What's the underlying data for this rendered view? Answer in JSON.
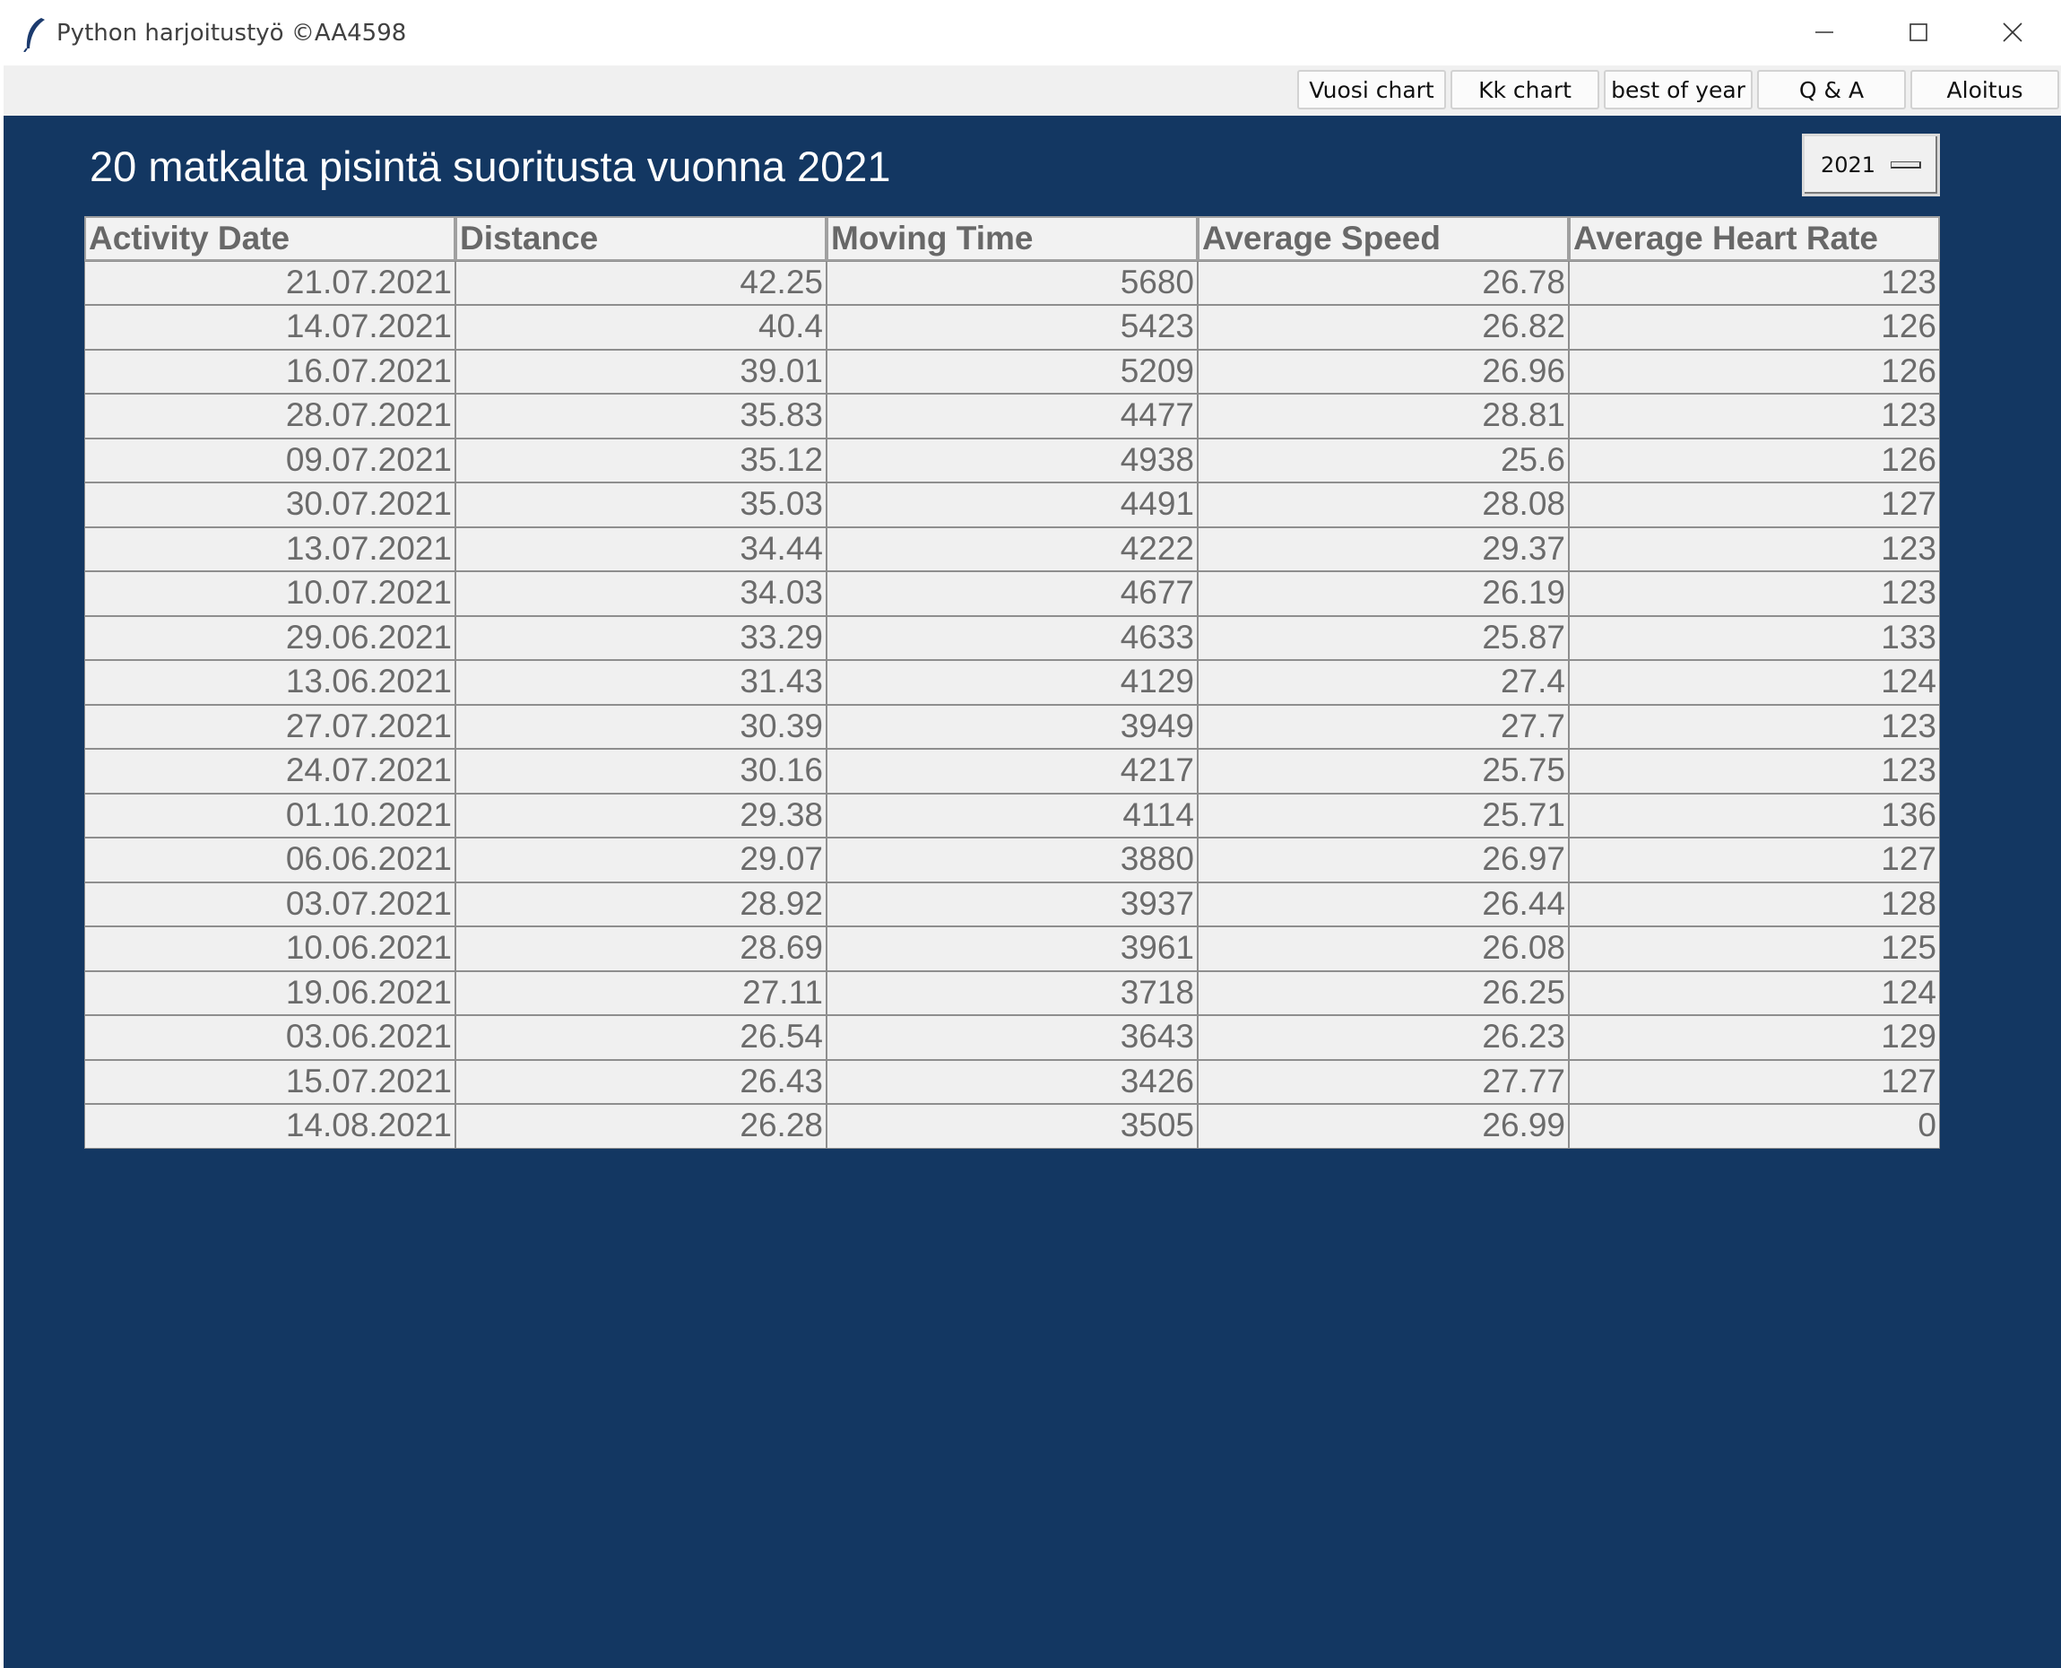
{
  "window": {
    "title": "Python harjoitustyö ©AA4598",
    "icon": "feather-icon"
  },
  "toolbar": {
    "buttons": [
      "Vuosi chart",
      "Kk chart",
      "best of year",
      "Q & A",
      "Aloitus"
    ]
  },
  "page": {
    "title": "20 matkalta pisintä suoritusta vuonna 2021",
    "year_selected": "2021"
  },
  "colors": {
    "background": "#133762",
    "cell": "#f0f0f0",
    "cell_text": "#6b6b6b"
  },
  "table": {
    "columns": [
      "Activity Date",
      "Distance",
      "Moving Time",
      "Average Speed",
      "Average Heart Rate"
    ],
    "rows": [
      [
        "21.07.2021",
        "42.25",
        "5680",
        "26.78",
        "123"
      ],
      [
        "14.07.2021",
        "40.4",
        "5423",
        "26.82",
        "126"
      ],
      [
        "16.07.2021",
        "39.01",
        "5209",
        "26.96",
        "126"
      ],
      [
        "28.07.2021",
        "35.83",
        "4477",
        "28.81",
        "123"
      ],
      [
        "09.07.2021",
        "35.12",
        "4938",
        "25.6",
        "126"
      ],
      [
        "30.07.2021",
        "35.03",
        "4491",
        "28.08",
        "127"
      ],
      [
        "13.07.2021",
        "34.44",
        "4222",
        "29.37",
        "123"
      ],
      [
        "10.07.2021",
        "34.03",
        "4677",
        "26.19",
        "123"
      ],
      [
        "29.06.2021",
        "33.29",
        "4633",
        "25.87",
        "133"
      ],
      [
        "13.06.2021",
        "31.43",
        "4129",
        "27.4",
        "124"
      ],
      [
        "27.07.2021",
        "30.39",
        "3949",
        "27.7",
        "123"
      ],
      [
        "24.07.2021",
        "30.16",
        "4217",
        "25.75",
        "123"
      ],
      [
        "01.10.2021",
        "29.38",
        "4114",
        "25.71",
        "136"
      ],
      [
        "06.06.2021",
        "29.07",
        "3880",
        "26.97",
        "127"
      ],
      [
        "03.07.2021",
        "28.92",
        "3937",
        "26.44",
        "128"
      ],
      [
        "10.06.2021",
        "28.69",
        "3961",
        "26.08",
        "125"
      ],
      [
        "19.06.2021",
        "27.11",
        "3718",
        "26.25",
        "124"
      ],
      [
        "03.06.2021",
        "26.54",
        "3643",
        "26.23",
        "129"
      ],
      [
        "15.07.2021",
        "26.43",
        "3426",
        "27.77",
        "127"
      ],
      [
        "14.08.2021",
        "26.28",
        "3505",
        "26.99",
        "0"
      ]
    ]
  }
}
